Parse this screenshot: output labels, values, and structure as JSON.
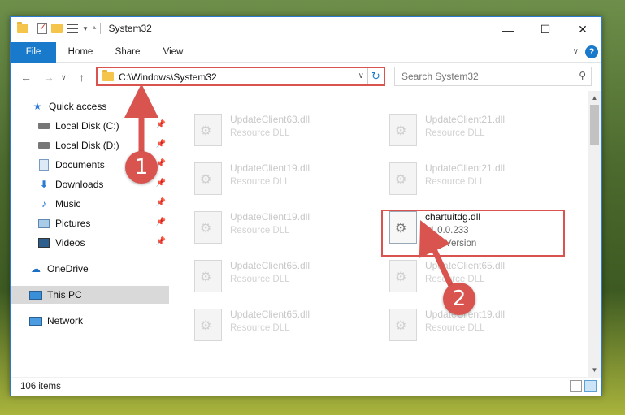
{
  "window": {
    "title": "System32",
    "controls": {
      "minimize": "—",
      "maximize": "☐",
      "close": "✕"
    }
  },
  "ribbon": {
    "tabs": [
      "File",
      "Home",
      "Share",
      "View"
    ],
    "help": "?"
  },
  "navigation": {
    "address": "C:\\Windows\\System32",
    "search_placeholder": "Search System32"
  },
  "sidebar": {
    "items": [
      {
        "label": "Quick access",
        "icon": "star-icon"
      },
      {
        "label": "Local Disk (C:)",
        "icon": "drive-icon",
        "pinned": true
      },
      {
        "label": "Local Disk (D:)",
        "icon": "drive-icon",
        "pinned": true
      },
      {
        "label": "Documents",
        "icon": "documents-icon",
        "pinned": true
      },
      {
        "label": "Downloads",
        "icon": "download-icon",
        "pinned": true
      },
      {
        "label": "Music",
        "icon": "music-icon",
        "pinned": true
      },
      {
        "label": "Pictures",
        "icon": "pictures-icon",
        "pinned": true
      },
      {
        "label": "Videos",
        "icon": "videos-icon",
        "pinned": true
      },
      {
        "label": "OneDrive",
        "icon": "cloud-icon"
      },
      {
        "label": "This PC",
        "icon": "computer-icon",
        "selected": true
      },
      {
        "label": "Network",
        "icon": "network-icon"
      }
    ]
  },
  "files": [
    {
      "name": "UpdateClient63.dll",
      "type": "Resource DLL"
    },
    {
      "name": "UpdateClient21.dll",
      "type": "Resource DLL"
    },
    {
      "name": "UpdateClient19.dll",
      "type": "Resource DLL"
    },
    {
      "name": "UpdateClient21.dll",
      "type": "Resource DLL"
    },
    {
      "name": "UpdateClient19.dll",
      "type": "Resource DLL"
    },
    {
      "name": "chartuitdg.dll",
      "version": "11.0.0.233",
      "type": "6FileVersion",
      "highlighted": true
    },
    {
      "name": "UpdateClient65.dll",
      "type": "Resource DLL"
    },
    {
      "name": "UpdateClient65.dll",
      "type": "Resource DLL"
    },
    {
      "name": "UpdateClient65.dll",
      "type": "Resource DLL"
    },
    {
      "name": "UpdateClient19.dll",
      "type": "Resource DLL"
    }
  ],
  "status": {
    "item_count": "106 items"
  },
  "annotations": {
    "step1": "1",
    "step2": "2",
    "color": "#d9534f"
  },
  "colors": {
    "accent": "#1979ca",
    "highlight": "#d9534f",
    "selection": "#d9d9d9"
  }
}
